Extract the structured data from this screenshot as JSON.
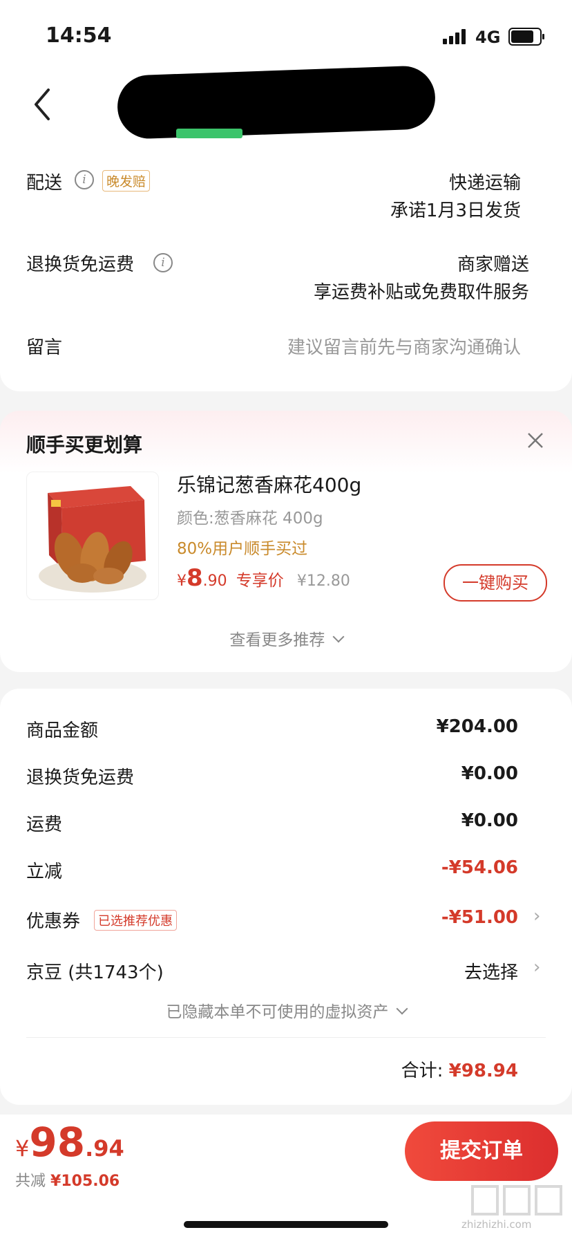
{
  "status_bar": {
    "time": "14:54",
    "network": "4G"
  },
  "delivery": {
    "label": "配送",
    "tag": "晚发赔",
    "method": "快递运输",
    "promise": "承诺1月3日发货"
  },
  "return_shipping": {
    "label": "退换货免运费",
    "value": "商家赠送",
    "desc": "享运费补贴或免费取件服务"
  },
  "message": {
    "label": "留言",
    "placeholder": "建议留言前先与商家沟通确认"
  },
  "recommend": {
    "title": "顺手买更划算",
    "product_name": "乐锦记葱香麻花400g",
    "variant": "颜色:葱香麻花 400g",
    "social_proof": "80%用户顺手买过",
    "currency": "¥",
    "price_int": "8",
    "price_dec": ".90",
    "price_tag": "专享价",
    "original_price": "¥12.80",
    "buy_button": "一键购买",
    "more": "查看更多推荐"
  },
  "summary": {
    "rows": [
      {
        "label": "商品金额",
        "value": "¥204.00"
      },
      {
        "label": "退换货免运费",
        "value": "¥0.00"
      },
      {
        "label": "运费",
        "value": "¥0.00"
      },
      {
        "label": "立减",
        "value": "-¥54.06"
      }
    ],
    "coupon_label": "优惠券",
    "coupon_tag": "已选推荐优惠",
    "coupon_value": "-¥51.00",
    "jingdou_label": "京豆 (共1743个)",
    "jingdou_value": "去选择",
    "hidden_assets": "已隐藏本单不可使用的虚拟资产",
    "total_label": "合计:",
    "total_value": "¥98.94"
  },
  "bottom_bar": {
    "currency": "¥",
    "price_int": "98",
    "price_dec": ".94",
    "saved_label": "共减",
    "saved_value": "¥105.06",
    "submit": "提交订单"
  },
  "watermark": {
    "text": "zhizhizhi.com"
  },
  "colors": {
    "accent": "#d43a2a",
    "tag_orange": "#c98a2b"
  }
}
